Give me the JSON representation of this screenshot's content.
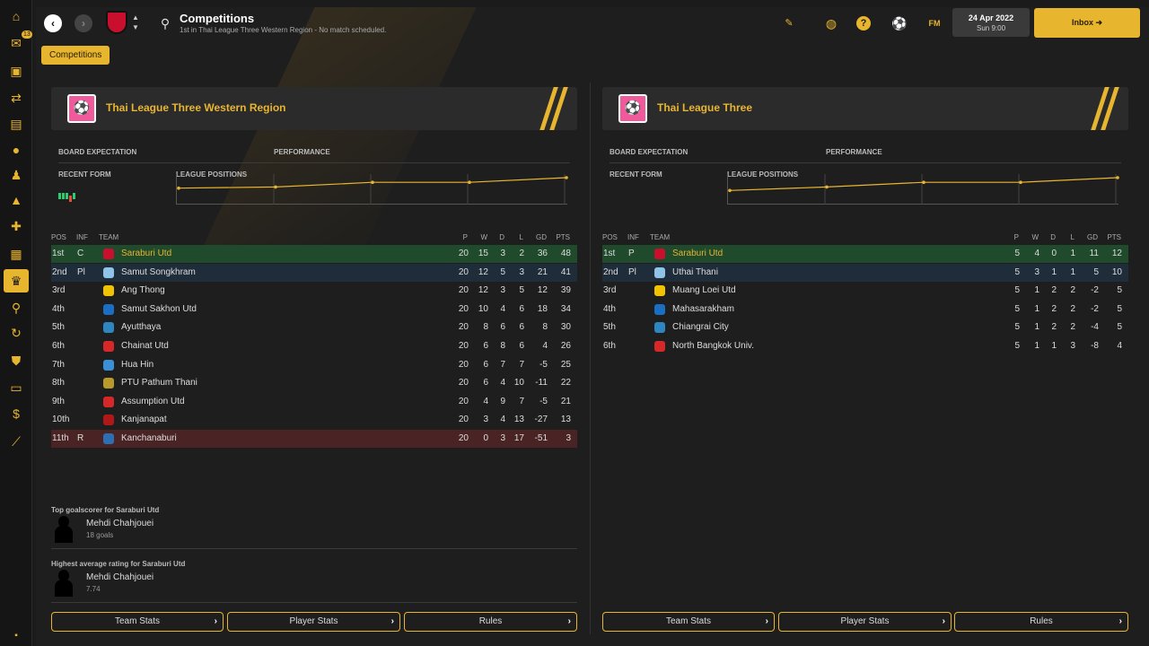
{
  "sidebar": {
    "inbox_count": "13"
  },
  "header": {
    "title": "Competitions",
    "subtitle": "1st in Thai League Three Western Region - No match scheduled.",
    "fm_label": "FM",
    "date": "24 Apr 2022",
    "time": "Sun 9:00",
    "inbox_label": "Inbox"
  },
  "breadcrumb": {
    "label": "Competitions"
  },
  "colors": {
    "accent": "#e8b52f",
    "champion_row": "#1f4a2b",
    "playoff_row": "#1f2c3a",
    "relegation_row": "#4a2424"
  },
  "left": {
    "name": "Thai League Three Western Region",
    "board_expectation": "BOARD EXPECTATION",
    "performance": "PERFORMANCE",
    "recent_form": "RECENT FORM",
    "league_positions": "LEAGUE POSITIONS",
    "cols": {
      "pos": "POS",
      "inf": "INF",
      "team": "TEAM",
      "p": "P",
      "w": "W",
      "d": "D",
      "l": "L",
      "gd": "GD",
      "pts": "PTS"
    },
    "positions_chart": {
      "type": "line",
      "values": [
        0.55,
        0.6,
        0.8,
        0.8,
        1.0
      ]
    },
    "rows": [
      {
        "pos": "1st",
        "inf": "C",
        "team": "Saraburi Utd",
        "p": "20",
        "w": "15",
        "d": "3",
        "l": "2",
        "gd": "36",
        "pts": "48"
      },
      {
        "pos": "2nd",
        "inf": "Pl",
        "team": "Samut Songkhram",
        "p": "20",
        "w": "12",
        "d": "5",
        "l": "3",
        "gd": "21",
        "pts": "41"
      },
      {
        "pos": "3rd",
        "inf": "",
        "team": "Ang Thong",
        "p": "20",
        "w": "12",
        "d": "3",
        "l": "5",
        "gd": "12",
        "pts": "39"
      },
      {
        "pos": "4th",
        "inf": "",
        "team": "Samut Sakhon Utd",
        "p": "20",
        "w": "10",
        "d": "4",
        "l": "6",
        "gd": "18",
        "pts": "34"
      },
      {
        "pos": "5th",
        "inf": "",
        "team": "Ayutthaya",
        "p": "20",
        "w": "8",
        "d": "6",
        "l": "6",
        "gd": "8",
        "pts": "30"
      },
      {
        "pos": "6th",
        "inf": "",
        "team": "Chainat Utd",
        "p": "20",
        "w": "6",
        "d": "8",
        "l": "6",
        "gd": "4",
        "pts": "26"
      },
      {
        "pos": "7th",
        "inf": "",
        "team": "Hua Hin",
        "p": "20",
        "w": "6",
        "d": "7",
        "l": "7",
        "gd": "-5",
        "pts": "25"
      },
      {
        "pos": "8th",
        "inf": "",
        "team": "PTU Pathum Thani",
        "p": "20",
        "w": "6",
        "d": "4",
        "l": "10",
        "gd": "-11",
        "pts": "22"
      },
      {
        "pos": "9th",
        "inf": "",
        "team": "Assumption Utd",
        "p": "20",
        "w": "4",
        "d": "9",
        "l": "7",
        "gd": "-5",
        "pts": "21"
      },
      {
        "pos": "10th",
        "inf": "",
        "team": "Kanjanapat",
        "p": "20",
        "w": "3",
        "d": "4",
        "l": "13",
        "gd": "-27",
        "pts": "13"
      },
      {
        "pos": "11th",
        "inf": "R",
        "team": "Kanchanaburi",
        "p": "20",
        "w": "0",
        "d": "3",
        "l": "17",
        "gd": "-51",
        "pts": "3"
      }
    ],
    "top_scorer_title": "Top goalscorer for Saraburi Utd",
    "top_scorer_name": "Mehdi Chahjouei",
    "top_scorer_value": "18 goals",
    "top_rating_title": "Highest average rating for Saraburi Utd",
    "top_rating_name": "Mehdi Chahjouei",
    "top_rating_value": "7.74",
    "buttons": [
      "Team Stats",
      "Player Stats",
      "Rules"
    ]
  },
  "right": {
    "name": "Thai League Three",
    "board_expectation": "BOARD EXPECTATION",
    "performance": "PERFORMANCE",
    "recent_form": "RECENT FORM",
    "league_positions": "LEAGUE POSITIONS",
    "cols": {
      "pos": "POS",
      "inf": "INF",
      "team": "TEAM",
      "p": "P",
      "w": "W",
      "d": "D",
      "l": "L",
      "gd": "GD",
      "pts": "PTS"
    },
    "positions_chart": {
      "type": "line",
      "values": [
        0.45,
        0.6,
        0.8,
        0.8,
        1.0
      ]
    },
    "rows": [
      {
        "pos": "1st",
        "inf": "P",
        "team": "Saraburi Utd",
        "p": "5",
        "w": "4",
        "d": "0",
        "l": "1",
        "gd": "11",
        "pts": "12"
      },
      {
        "pos": "2nd",
        "inf": "Pl",
        "team": "Uthai Thani",
        "p": "5",
        "w": "3",
        "d": "1",
        "l": "1",
        "gd": "5",
        "pts": "10"
      },
      {
        "pos": "3rd",
        "inf": "",
        "team": "Muang Loei Utd",
        "p": "5",
        "w": "1",
        "d": "2",
        "l": "2",
        "gd": "-2",
        "pts": "5"
      },
      {
        "pos": "4th",
        "inf": "",
        "team": "Mahasarakham",
        "p": "5",
        "w": "1",
        "d": "2",
        "l": "2",
        "gd": "-2",
        "pts": "5"
      },
      {
        "pos": "5th",
        "inf": "",
        "team": "Chiangrai City",
        "p": "5",
        "w": "1",
        "d": "2",
        "l": "2",
        "gd": "-4",
        "pts": "5"
      },
      {
        "pos": "6th",
        "inf": "",
        "team": "North Bangkok Univ.",
        "p": "5",
        "w": "1",
        "d": "1",
        "l": "3",
        "gd": "-8",
        "pts": "4"
      }
    ],
    "buttons": [
      "Team Stats",
      "Player Stats",
      "Rules"
    ]
  }
}
